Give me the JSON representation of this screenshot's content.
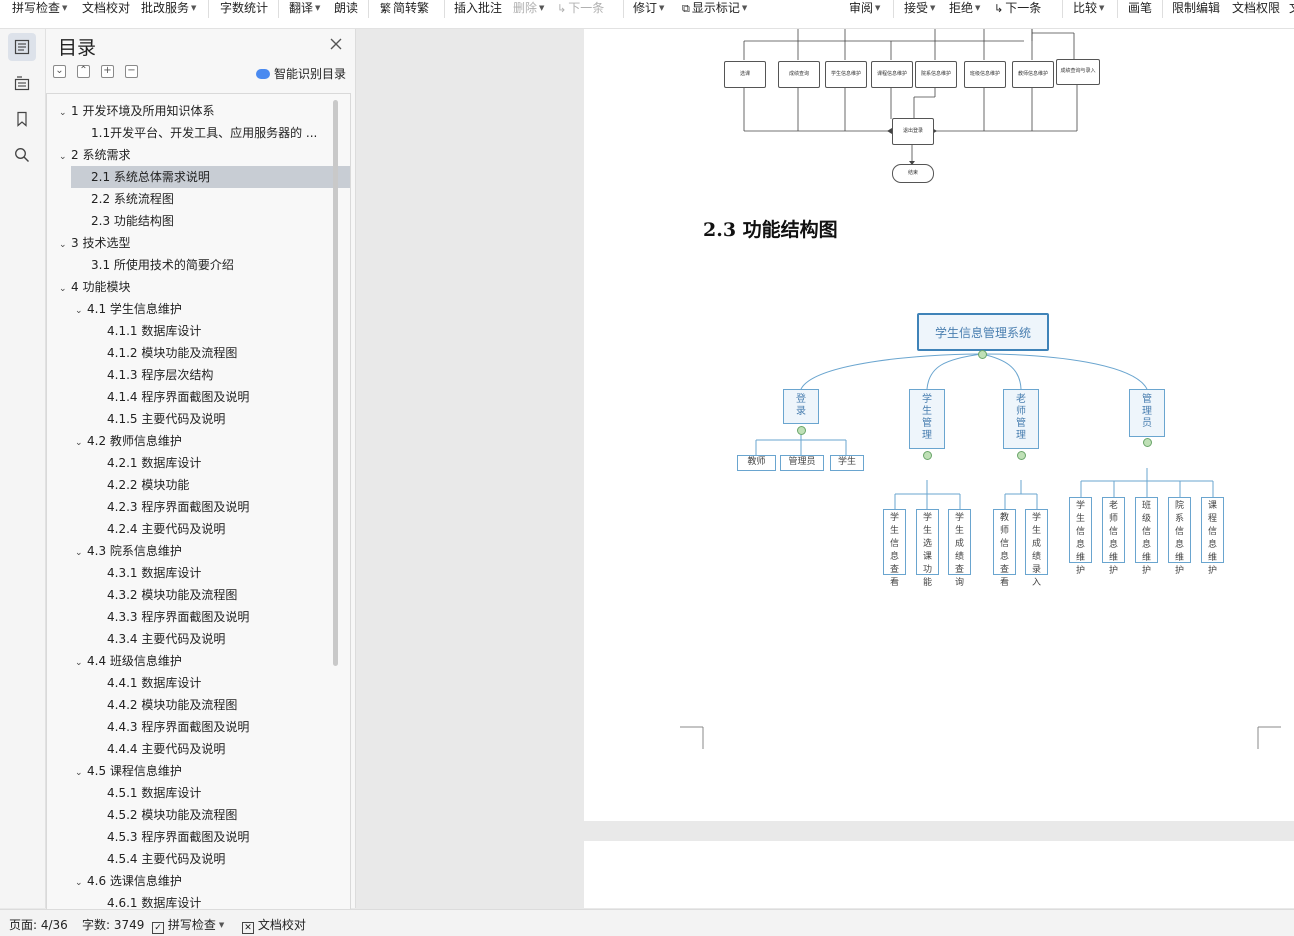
{
  "toolbar": {
    "spell_check": "拼写检查",
    "doc_proofread": "文档校对",
    "review_service": "批改服务",
    "word_count": "字数统计",
    "translate": "翻译",
    "read_aloud": "朗读",
    "simp_trad": "简转繁",
    "insert_comment": "插入批注",
    "delete": "删除",
    "next_item_disabled": "下一条",
    "track_changes": "修订",
    "show_markup": "显示标记",
    "review": "审阅",
    "accept": "接受",
    "reject": "拒绝",
    "next_item": "下一条",
    "compare": "比较",
    "pen": "画笔",
    "restrict_edit": "限制编辑",
    "doc_permission": "文档权限",
    "overflow_char": "文"
  },
  "toc": {
    "title": "目录",
    "smart_label": "智能识别目录",
    "items": [
      {
        "label": "1  开发环境及所用知识体系",
        "level": 0,
        "expanded": true
      },
      {
        "label": "1.1开发平台、开发工具、应用服务器的 ...",
        "level": 1
      },
      {
        "label": "2  系统需求",
        "level": 0,
        "expanded": true
      },
      {
        "label": "2.1  系统总体需求说明",
        "level": 1,
        "selected": true
      },
      {
        "label": "2.2  系统流程图",
        "level": 1
      },
      {
        "label": "2.3  功能结构图",
        "level": 1
      },
      {
        "label": "3  技术选型",
        "level": 0,
        "expanded": true
      },
      {
        "label": "3.1  所使用技术的简要介绍",
        "level": 1
      },
      {
        "label": "4  功能模块",
        "level": 0,
        "expanded": true
      },
      {
        "label": "4.1  学生信息维护",
        "level": 1,
        "expanded": true
      },
      {
        "label": "4.1.1  数据库设计",
        "level": 2
      },
      {
        "label": "4.1.2  模块功能及流程图",
        "level": 2
      },
      {
        "label": "4.1.3  程序层次结构",
        "level": 2
      },
      {
        "label": "4.1.4  程序界面截图及说明",
        "level": 2
      },
      {
        "label": "4.1.5  主要代码及说明",
        "level": 2
      },
      {
        "label": "4.2  教师信息维护",
        "level": 1,
        "expanded": true
      },
      {
        "label": "4.2.1  数据库设计",
        "level": 2
      },
      {
        "label": "4.2.2  模块功能",
        "level": 2
      },
      {
        "label": "4.2.3  程序界面截图及说明",
        "level": 2
      },
      {
        "label": "4.2.4  主要代码及说明",
        "level": 2
      },
      {
        "label": "4.3  院系信息维护",
        "level": 1,
        "expanded": true
      },
      {
        "label": "4.3.1  数据库设计",
        "level": 2
      },
      {
        "label": "4.3.2 模块功能及流程图",
        "level": 2
      },
      {
        "label": "4.3.3  程序界面截图及说明",
        "level": 2
      },
      {
        "label": "4.3.4 主要代码及说明",
        "level": 2
      },
      {
        "label": "4.4  班级信息维护",
        "level": 1,
        "expanded": true
      },
      {
        "label": "4.4.1  数据库设计",
        "level": 2
      },
      {
        "label": "4.4.2  模块功能及流程图",
        "level": 2
      },
      {
        "label": "4.4.3 程序界面截图及说明",
        "level": 2
      },
      {
        "label": "4.4.4 主要代码及说明",
        "level": 2
      },
      {
        "label": "4.5  课程信息维护",
        "level": 1,
        "expanded": true
      },
      {
        "label": "4.5.1  数据库设计",
        "level": 2
      },
      {
        "label": "4.5.2  模块功能及流程图",
        "level": 2
      },
      {
        "label": "4.5.3 程序界面截图及说明",
        "level": 2
      },
      {
        "label": "4.5.4 主要代码及说明",
        "level": 2
      },
      {
        "label": "4.6  选课信息维护",
        "level": 1,
        "expanded": true
      },
      {
        "label": "4.6.1  数据库设计",
        "level": 2
      }
    ]
  },
  "document": {
    "heading": "2.3  功能结构图",
    "flowchart": {
      "nodes": [
        "选课",
        "成绩查询",
        "学生信息维护",
        "课程信息维护",
        "院系信息维护",
        "班级信息维护",
        "教师信息维护",
        "成绩查询与录入"
      ],
      "exit_node": "退出登录",
      "end_node": "结束"
    },
    "structure": {
      "root": "学生信息管理系统",
      "branches": [
        {
          "label": "登录",
          "children": [
            "教师",
            "管理员",
            "学生"
          ]
        },
        {
          "label": "学生管理",
          "children": [
            "学生信息查看",
            "学生选课功能",
            "学生成绩查询"
          ]
        },
        {
          "label": "老师管理",
          "children": [
            "教师信息查看",
            "学生成绩录入"
          ]
        },
        {
          "label": "管理员",
          "children": [
            "学生信息维护",
            "老师信息维护",
            "班级信息维护",
            "院系信息维护",
            "课程信息维护"
          ]
        }
      ]
    }
  },
  "status": {
    "page": "页面: 4/36",
    "words": "字数: 3749",
    "spell_check": "拼写检查",
    "doc_proofread": "文档校对"
  }
}
